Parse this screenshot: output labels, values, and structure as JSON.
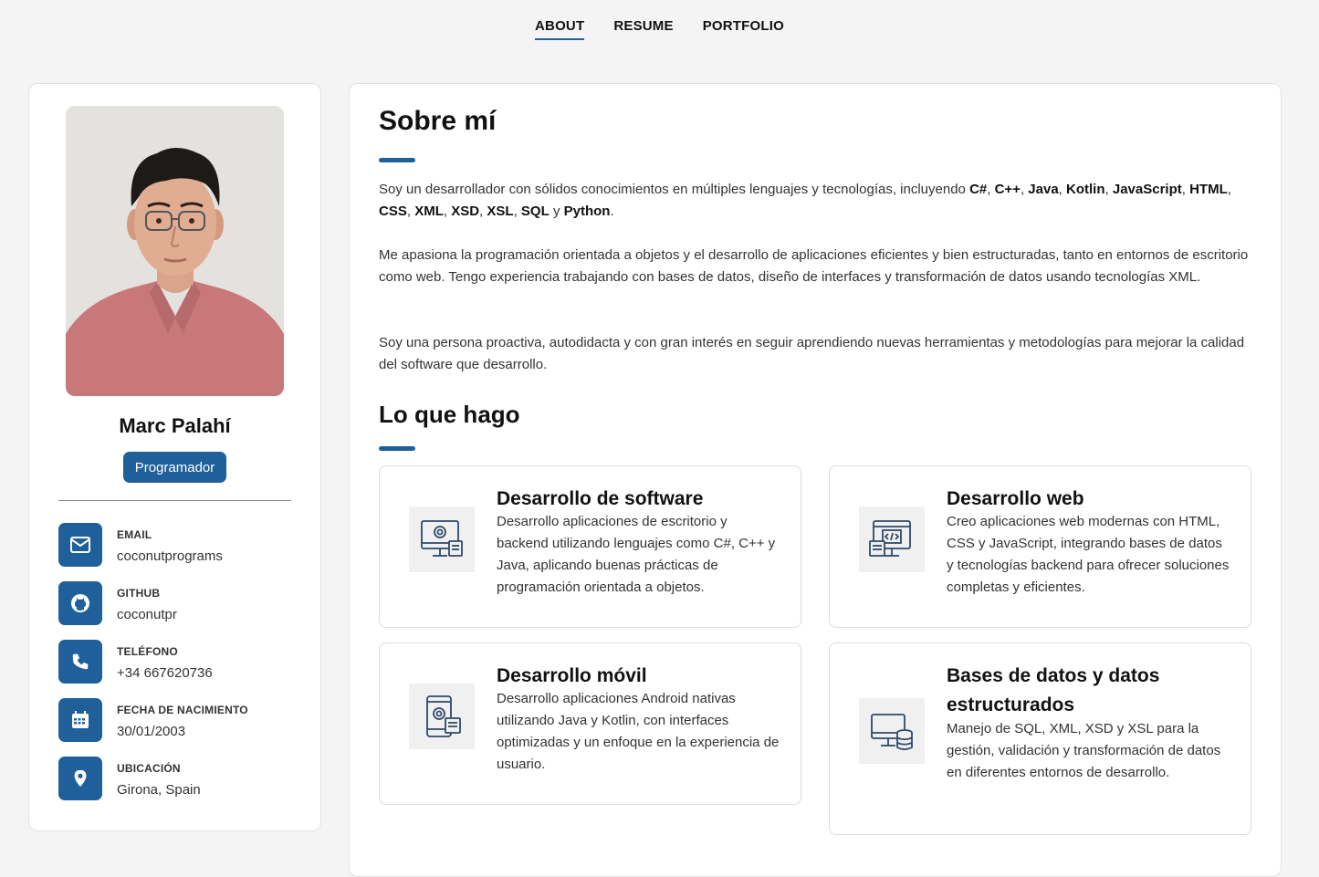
{
  "nav": {
    "about": "ABOUT",
    "resume": "RESUME",
    "portfolio": "PORTFOLIO"
  },
  "profile": {
    "name": "Marc Palahí",
    "role": "Programador",
    "contacts": [
      {
        "label": "EMAIL",
        "value": "coconutprograms",
        "icon": "envelope-icon"
      },
      {
        "label": "GITHUB",
        "value": "coconutpr",
        "icon": "github-icon"
      },
      {
        "label": "TELÉFONO",
        "value": "+34 667620736",
        "icon": "phone-icon"
      },
      {
        "label": "FECHA DE NACIMIENTO",
        "value": "30/01/2003",
        "icon": "calendar-icon"
      },
      {
        "label": "UBICACIÓN",
        "value": "Girona, Spain",
        "icon": "location-pin-icon"
      }
    ]
  },
  "about": {
    "title": "Sobre mí",
    "p1_intro": "Soy un desarrollador con sólidos conocimientos en múltiples lenguajes y tecnologías, incluyendo",
    "p1_techs": [
      "C#",
      "C++",
      "Java",
      "Kotlin",
      "JavaScript",
      "HTML",
      "CSS",
      "XML",
      "XSD",
      "XSL",
      "SQL",
      "Python"
    ],
    "p1_and": "y",
    "p2": "Me apasiona la programación orientada a objetos y el desarrollo de aplicaciones eficientes y bien estructuradas, tanto en entornos de escritorio como web. Tengo experiencia trabajando con bases de datos, diseño de interfaces y transformación de datos usando tecnologías XML.",
    "p3": "Soy una persona proactiva, autodidacta y con gran interés en seguir aprendiendo nuevas herramientas y metodologías para mejorar la calidad del software que desarrollo."
  },
  "services": {
    "title": "Lo que hago",
    "items": [
      {
        "title": "Desarrollo de software",
        "text": "Desarrollo aplicaciones de escritorio y backend utilizando lenguajes como C#, C++ y Java, aplicando buenas prácticas de programación orientada a objetos.",
        "icon": "monitor-gear-icon"
      },
      {
        "title": "Desarrollo web",
        "text": "Creo aplicaciones web modernas con HTML, CSS y JavaScript, integrando bases de datos y tecnologías backend para ofrecer soluciones completas y eficientes.",
        "icon": "web-code-icon"
      },
      {
        "title": "Desarrollo móvil",
        "text": "Desarrollo aplicaciones Android nativas utilizando Java y Kotlin, con interfaces optimizadas y un enfoque en la experiencia de usuario.",
        "icon": "mobile-gear-icon"
      },
      {
        "title": "Bases de datos y datos estructurados",
        "text": "Manejo de SQL, XML, XSD y XSL para la gestión, validación y transformación de datos en diferentes entornos de desarrollo.",
        "icon": "database-monitor-icon"
      }
    ]
  },
  "colors": {
    "accent": "#1f5f9a",
    "background": "#f4f4f4",
    "card": "#ffffff"
  }
}
